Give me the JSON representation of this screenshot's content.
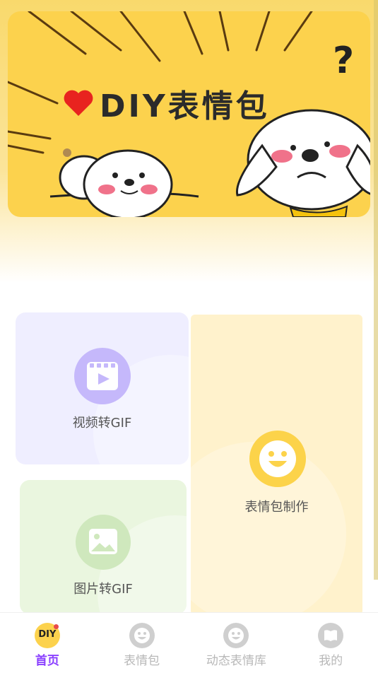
{
  "banner": {
    "title": "DIY表情包",
    "question_mark": "?"
  },
  "cards": {
    "video_to_gif": "视频转GIF",
    "image_to_gif": "图片转GIF",
    "emoji_maker": "表情包制作"
  },
  "tabbar": {
    "items": [
      {
        "label": "首页",
        "active": true,
        "icon": "diy-home-icon"
      },
      {
        "label": "表情包",
        "active": false,
        "icon": "smiley-icon"
      },
      {
        "label": "动态表情库",
        "active": false,
        "icon": "smiley-icon"
      },
      {
        "label": "我的",
        "active": false,
        "icon": "book-icon"
      }
    ],
    "home_icon_text": "DIY"
  },
  "colors": {
    "accent": "#8a3fff",
    "banner_yellow": "#fcd24d",
    "video_card": "#efeeff",
    "image_card": "#eaf6df",
    "emoji_card": "#fff2cc"
  }
}
